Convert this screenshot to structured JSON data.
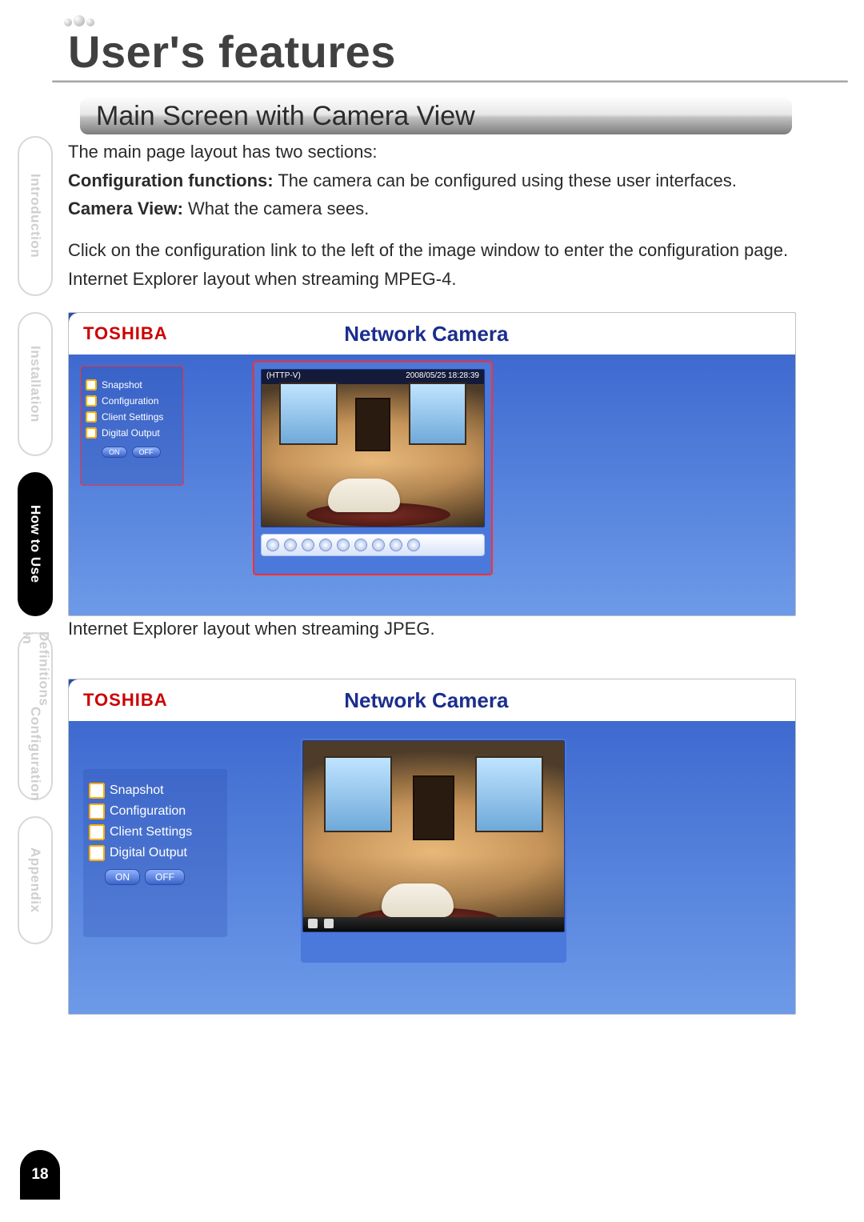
{
  "chapter_title": "User's features",
  "section_title": "Main Screen with Camera View",
  "page_number": "18",
  "nav": {
    "introduction": "Introduction",
    "installation": "Installation",
    "how_to_use": "How to Use",
    "definitions_line1": "Definitions in",
    "definitions_line2": "Configuration",
    "appendix": "Appendix"
  },
  "body": {
    "p1": "The main page layout has two sections:",
    "p2_label": "Configuration functions:",
    "p2_rest": " The camera can be configured using these user interfaces.",
    "p3_label": "Camera View:",
    "p3_rest": " What the camera sees.",
    "p4": "Click on the configuration link to the left of the image window to enter the configuration page.",
    "cap1": "Internet Explorer layout when streaming MPEG-4.",
    "cap2": "Internet Explorer layout when streaming JPEG."
  },
  "screenshot": {
    "brand": "TOSHIBA",
    "title": "Network Camera",
    "overlay_left": "(HTTP-V)",
    "overlay_right": "2008/05/25 18:28:39",
    "sidebar": {
      "snapshot": "Snapshot",
      "configuration": "Configuration",
      "client_settings": "Client Settings",
      "digital_output": "Digital Output",
      "on": "ON",
      "off": "OFF"
    }
  }
}
